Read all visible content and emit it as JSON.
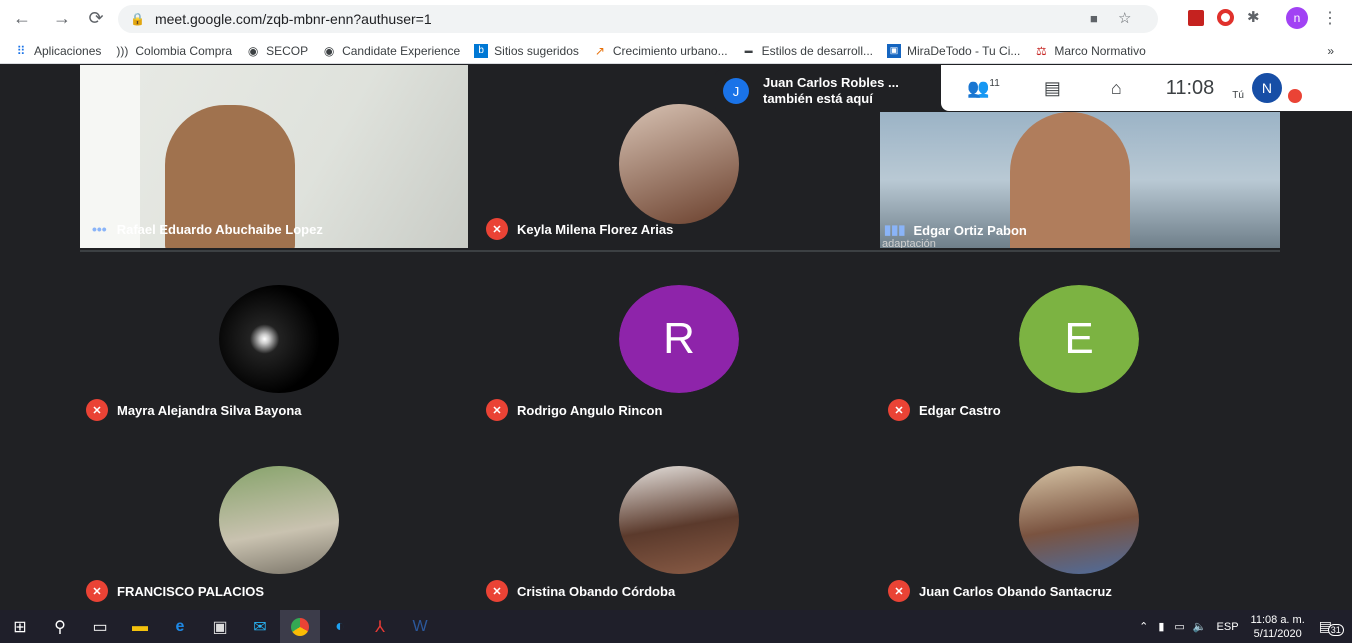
{
  "browser": {
    "url": "meet.google.com/zqb-mbnr-enn?authuser=1",
    "profile_initial": "n"
  },
  "bookmarks": [
    {
      "label": "Aplicaciones",
      "icon": "apps-grid-icon"
    },
    {
      "label": "Colombia Compra",
      "icon": "colombia-compra-icon"
    },
    {
      "label": "SECOP",
      "icon": "globe-icon"
    },
    {
      "label": "Candidate Experience",
      "icon": "globe-icon"
    },
    {
      "label": "Sitios sugeridos",
      "icon": "bing-icon"
    },
    {
      "label": "Crecimiento urbano...",
      "icon": "chart-icon"
    },
    {
      "label": "Estilos de desarroll...",
      "icon": "site-icon"
    },
    {
      "label": "MiraDeTodo - Tu Ci...",
      "icon": "tv-icon"
    },
    {
      "label": "Marco Normativo",
      "icon": "scale-icon"
    }
  ],
  "bookmarks_overflow": "»",
  "meet": {
    "notice": {
      "initial": "J",
      "line1": "Juan Carlos Robles ...",
      "line2": "también está aquí"
    },
    "participants_count": "11",
    "time": "11:08",
    "self_label": "Tú",
    "self_initial": "N",
    "participants": [
      {
        "name": "Rafael Eduardo Abuchaibe Lopez",
        "type": "video",
        "muted": false
      },
      {
        "name": "Keyla Milena Florez Arias",
        "type": "photo",
        "muted": true
      },
      {
        "name": "Edgar Ortiz Pabon",
        "type": "video",
        "muted": false,
        "overlay": "adaptación"
      },
      {
        "name": "Mayra Alejandra Silva Bayona",
        "type": "photo",
        "muted": true
      },
      {
        "name": "Rodrigo Angulo Rincon",
        "type": "letter",
        "letter": "R",
        "color": "#8e24aa",
        "muted": true
      },
      {
        "name": "Edgar Castro",
        "type": "letter",
        "letter": "E",
        "color": "#7cb342",
        "muted": true
      },
      {
        "name": "FRANCISCO PALACIOS",
        "type": "photo",
        "muted": true
      },
      {
        "name": "Cristina Obando Córdoba",
        "type": "photo",
        "muted": true
      },
      {
        "name": "Juan Carlos Obando Santacruz",
        "type": "photo",
        "muted": true
      }
    ]
  },
  "taskbar": {
    "language": "ESP",
    "time": "11:08 a. m.",
    "date": "5/11/2020",
    "notifications": "31"
  }
}
